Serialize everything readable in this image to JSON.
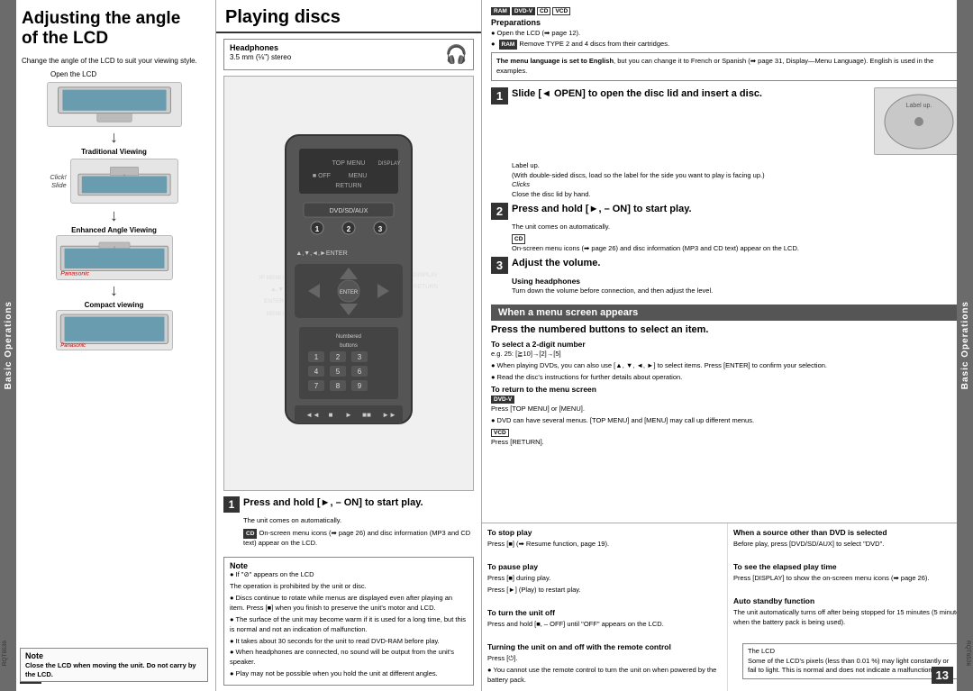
{
  "leftPanel": {
    "title": "Adjusting the angle\nof the LCD",
    "intro": "Change the angle of the LCD to suit your viewing style.",
    "openLCD": "Open the LCD",
    "labels": {
      "traditional": "Traditional Viewing",
      "enhanced": "Enhanced Angle Viewing",
      "compact": "Compact viewing",
      "click": "Click!",
      "slide": "Slide"
    },
    "sideLabel": "Basic Operations",
    "pageNum": "12",
    "note": {
      "title": "Note",
      "text": "Close the LCD when moving the unit.\nDo not carry by the LCD."
    },
    "rqt": "RQT6536"
  },
  "centerPanel": {
    "title": "Playing discs",
    "headphones": {
      "title": "Headphones",
      "sub": "3.5 mm (⅛\") stereo"
    },
    "remoteLabels": {
      "topMenu": "TOP MENU",
      "off": "■ OFF",
      "menu": "MENU",
      "return": "RETURN",
      "display": "DISPLAY",
      "dvdSdAux": "DVD/SD/AUX",
      "enter": "▲,▼,◄,►ENTER",
      "topMenuBtn": "TOP MENU",
      "displayBtn": "DISPLAY",
      "enterBtn": "ENTER",
      "returnBtn": "RETURN",
      "menuBtn": "MENU",
      "numberedButtons": "Numbered\nbuttons",
      "num1": "1",
      "num2": "2",
      "num3": "3"
    },
    "step1": {
      "num": "1",
      "text": "Press and hold [►, – ON] to start play.",
      "sub1": "The unit comes on automatically.",
      "sub2": "On-screen menu icons (➡ page 26) and disc information (MP3 and CD text) appear on the LCD."
    },
    "note": {
      "title": "Note",
      "items": [
        "If \"⊘\" appears on the LCD",
        "The operation is prohibited by the unit or disc.",
        "Discs continue to rotate while menus are displayed even after playing an item. Press [■] when you finish to preserve the unit's motor and LCD.",
        "The surface of the unit may become warm if it is used for a long time, but this is normal and not an indication of malfunction.",
        "It takes about 30 seconds for the unit to read DVD-RAM before play.",
        "When headphones are connected, no sound will be output from the unit's speaker.",
        "Play may not be possible when you hold the unit at different angles."
      ]
    },
    "rqt": "RQT6536"
  },
  "rightPanel": {
    "badges": [
      "RAM",
      "DVD-V",
      "CD",
      "VCD"
    ],
    "preparations": {
      "title": "Preparations",
      "items": [
        "Open the LCD (➡ page 12).",
        "RAM  Remove TYPE 2 and 4 discs from their cartridges."
      ]
    },
    "menuLang": "The menu language is set to English, but you can change it to French or Spanish (➡ page 31, Display—Menu Language). English is used in the examples.",
    "step1": {
      "num": "1",
      "text": "Slide [◄ OPEN] to open the disc lid and insert a disc.",
      "notes": [
        "Label up.",
        "(With double-sided discs, load so the label for the side you want to play is facing up.)",
        "Clicks",
        "Close the disc lid by hand."
      ]
    },
    "step2": {
      "num": "2",
      "text": "Press and hold [►, – ON] to start play.",
      "sub": "The unit comes on automatically.",
      "cdNote": "On-screen menu icons (➡ page 26) and disc information (MP3 and CD text) appear on the LCD."
    },
    "step3": {
      "num": "3",
      "text": "Adjust the volume.",
      "subTitle": "Using headphones",
      "subText": "Turn down the volume before connection, and then adjust the level."
    },
    "menuScreenBox": "When a menu screen appears",
    "pressNumbered": "Press the numbered buttons to select an item.",
    "selectDigit": {
      "title": "To select a 2-digit number",
      "text": "e.g. 25: [≧10]→[2]→[5]",
      "bullet": "When playing DVDs, you can also use [▲, ▼, ◄, ►] to select items. Press [ENTER] to confirm your selection.",
      "bullet2": "Read the disc's instructions for further details about operation."
    },
    "returnMenu": {
      "title": "To return to the menu screen",
      "dvdBadge": "DVD-V",
      "text": "Press [TOP MENU] or [MENU].",
      "bullet": "DVD can have several menus. [TOP MENU] and [MENU] may call up different menus.",
      "vcdTitle": "VCD",
      "vcdText": "Press [RETURN]."
    },
    "bottomNotes": {
      "stopPlay": {
        "title": "To stop play",
        "text": "Press [■] (➡ Resume function, page 19)."
      },
      "pausePlay": {
        "title": "To pause play",
        "line1": "Press [■] during play.",
        "line2": "Press [►] (Play) to restart play."
      },
      "turnOff": {
        "title": "To turn the unit off",
        "text": "Press and hold [■, – OFF] until \"OFF\" appears on the LCD."
      },
      "turningOn": {
        "title": "Turning the unit on and off with the remote control",
        "text": "Press [⏻].",
        "note": "You cannot use the remote control to turn the unit on when powered by the battery pack."
      },
      "otherSource": {
        "title": "When a source other than DVD is selected",
        "text": "Before play, press [DVD/SD/AUX] to select \"DVD\"."
      },
      "elapsedTime": {
        "title": "To see the elapsed play time",
        "text": "Press [DISPLAY] to show the on-screen menu icons (➡ page 26)."
      },
      "autoStandby": {
        "title": "Auto standby function",
        "text": "The unit automatically turns off after being stopped for 15 minutes (5 minutes when the battery pack is being used)."
      }
    },
    "lcdNote": {
      "title": "The LCD",
      "text": "Some of the LCD's pixels (less than 0.01 %) may light constantly or fail to light. This is normal and does not indicate a malfunction."
    },
    "sideLabel": "Basic Operations",
    "pageNum": "13",
    "rqt": "RQT6536"
  }
}
